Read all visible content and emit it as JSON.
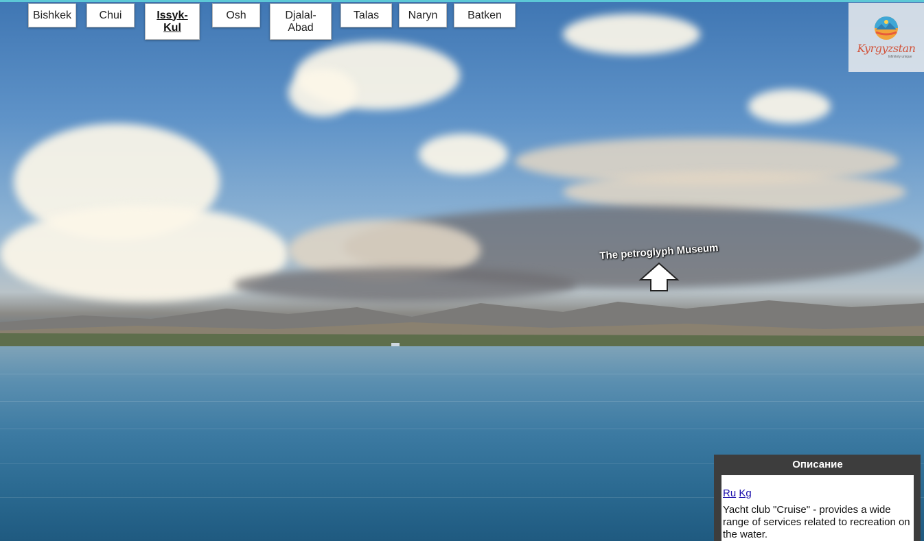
{
  "nav": {
    "tabs": [
      {
        "label": "Bishkek"
      },
      {
        "label": "Chui"
      },
      {
        "label": "Issyk-Kul",
        "active": true
      },
      {
        "label": "Osh"
      },
      {
        "label": "Djalal-Abad"
      },
      {
        "label": "Talas"
      },
      {
        "label": "Naryn"
      },
      {
        "label": "Batken"
      }
    ]
  },
  "logo": {
    "wordmark": "Kyrgyzstan",
    "tagline": "Infinitely unique"
  },
  "hotspot": {
    "label": "The petroglyph Museum",
    "icon": "up-arrow-icon"
  },
  "description": {
    "title": "Описание",
    "lang_ru": "Ru",
    "lang_kg": "Kg",
    "text": "Yacht club \"Cruise\" - provides a wide range of services related to recreation on the water."
  },
  "colors": {
    "accent_bar": "#5cc8d6",
    "panel_bg": "#3d3d3d",
    "logo_text": "#d2533a"
  }
}
